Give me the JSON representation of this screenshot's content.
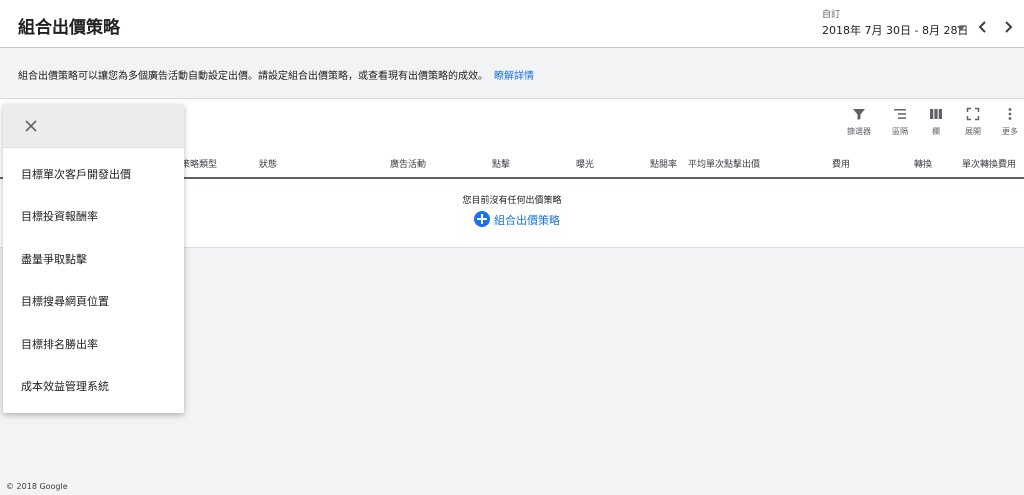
{
  "header": {
    "title": "組合出價策略",
    "date_label": "自訂",
    "date_range": "2018年 7月 30日 - 8月 28日"
  },
  "info": {
    "text": "組合出價策略可以讓您為多個廣告活動自動設定出價。請設定組合出價策略，或查看現有出價策略的成效。",
    "link": "瞭解詳情"
  },
  "toolbar": {
    "filter": "篩選器",
    "segment": "區隔",
    "columns": "欄",
    "expand": "展開",
    "more": "更多"
  },
  "table": {
    "columns": [
      "策略類型",
      "狀態",
      "廣告活動",
      "點擊",
      "曝光",
      "點閱率",
      "平均單次點擊出價",
      "費用",
      "轉換",
      "單次轉換費用"
    ],
    "empty_message": "您目前沒有任何出價策略",
    "add_label": "組合出價策略"
  },
  "menu": {
    "items": [
      "目標單次客戶開發出價",
      "目標投資報酬率",
      "盡量爭取點擊",
      "目標搜尋網頁位置",
      "目標排名勝出率",
      "成本效益管理系統"
    ]
  },
  "footer": {
    "copyright": "© 2018 Google"
  },
  "colors": {
    "link": "#1a73e8",
    "icon": "#5f6368",
    "background": "#f1f3f4"
  }
}
